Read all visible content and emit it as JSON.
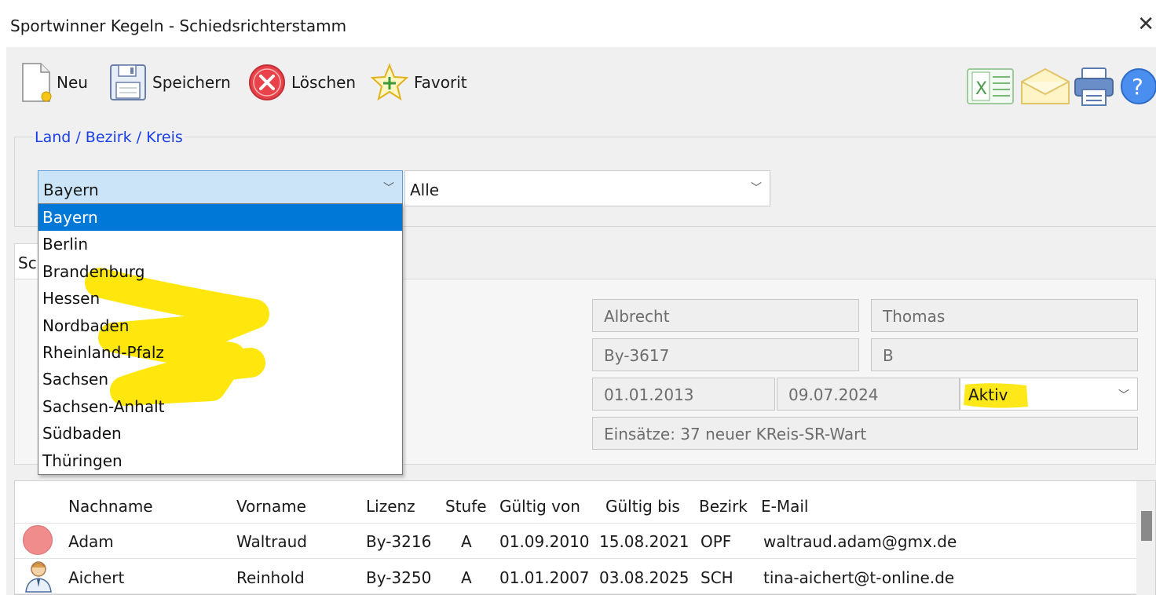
{
  "window": {
    "title": "Sportwinner Kegeln - Schiedsrichterstamm",
    "close": "✕"
  },
  "toolbar": {
    "neu": "Neu",
    "speichern": "Speichern",
    "loeschen": "Löschen",
    "favorit": "Favorit"
  },
  "filter": {
    "legend": "Land / Bezirk / Kreis",
    "land_value": "Bayern",
    "bezirk_value": "Alle",
    "land_options": [
      "Bayern",
      "Berlin",
      "Brandenburg",
      "Hessen",
      "Nordbaden",
      "Rheinland-Pfalz",
      "Sachsen",
      "Sachsen-Anhalt",
      "Südbaden",
      "Thüringen"
    ]
  },
  "tab": {
    "label": "Sc"
  },
  "detail": {
    "nachname": "Albrecht",
    "vorname": "Thomas",
    "lizenz": "By-3617",
    "stufe": "B",
    "gueltig_von": "01.01.2013",
    "gueltig_bis": "09.07.2024",
    "status": "Aktiv",
    "bemerkung": "Einsätze: 37 neuer KReis-SR-Wart"
  },
  "table": {
    "columns": [
      "Nachname",
      "Vorname",
      "Lizenz",
      "Stufe",
      "Gültig von",
      "Gültig bis",
      "Bezirk",
      "E-Mail"
    ],
    "rows": [
      [
        "Adam",
        "Waltraud",
        "By-3216",
        "A",
        "01.09.2010",
        "15.08.2021",
        "OPF",
        "waltraud.adam@gmx.de"
      ],
      [
        "Aichert",
        "Reinhold",
        "By-3250",
        "A",
        "01.01.2007",
        "03.08.2025",
        "SCH",
        "tina-aichert@t-online.de"
      ]
    ]
  },
  "colors": {
    "accent": "#0078d7",
    "legend": "#1a3fe8",
    "highlight": "#ffe600"
  }
}
